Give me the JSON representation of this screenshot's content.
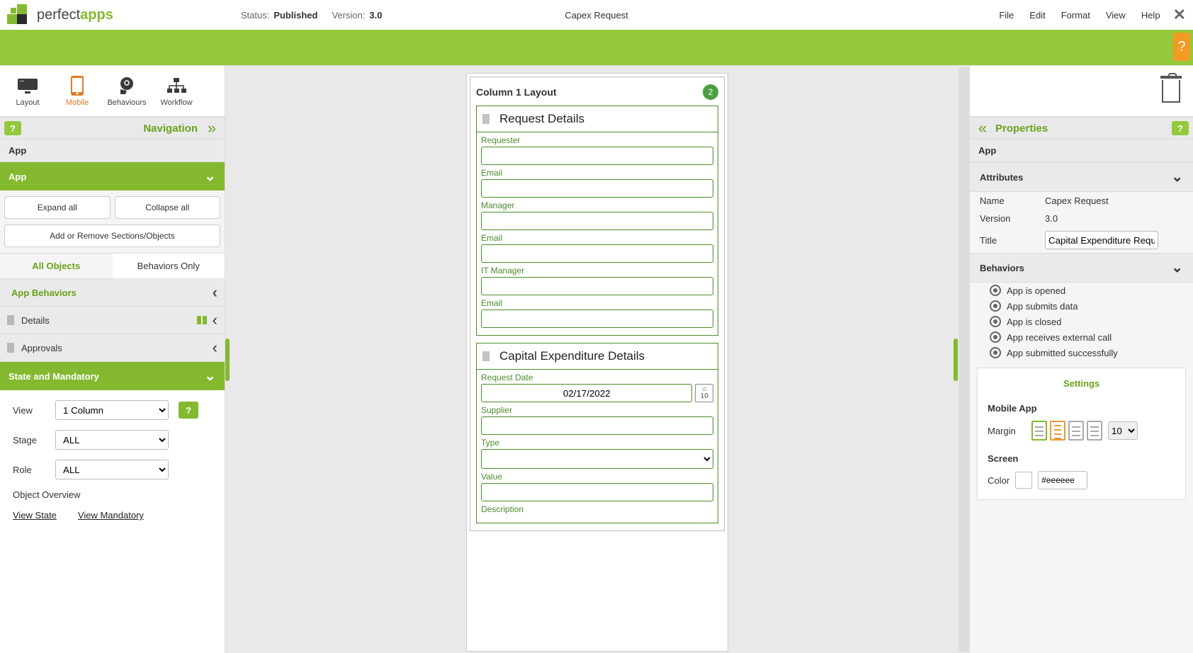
{
  "branding": {
    "name1": "perfect",
    "name2": "apps"
  },
  "header": {
    "status_label": "Status:",
    "status_value": "Published",
    "version_label": "Version:",
    "version_value": "3.0",
    "app_title": "Capex Request",
    "menu": {
      "file": "File",
      "edit": "Edit",
      "format": "Format",
      "view": "View",
      "help": "Help"
    }
  },
  "tools": {
    "layout": "Layout",
    "mobile": "Mobile",
    "behaviours": "Behaviours",
    "workflow": "Workflow"
  },
  "nav": {
    "title": "Navigation",
    "section_label": "App",
    "app_expand": "App",
    "expand_all": "Expand all",
    "collapse_all": "Collapse all",
    "add_remove": "Add or Remove Sections/Objects",
    "tab_all": "All Objects",
    "tab_beh": "Behaviors Only",
    "app_behaviors": "App Behaviors",
    "details": "Details",
    "approvals": "Approvals",
    "state_mand": "State and Mandatory",
    "view_label": "View",
    "view_value": "1 Column",
    "stage_label": "Stage",
    "stage_value": "ALL",
    "role_label": "Role",
    "role_value": "ALL",
    "overview": "Object Overview",
    "view_state": "View State",
    "view_mandatory": "View Mandatory"
  },
  "canvas": {
    "title": "Column 1 Layout",
    "badge": "2",
    "sec1_title": "Request Details",
    "f_requester": "Requester",
    "f_email": "Email",
    "f_manager": "Manager",
    "f_email2": "Email",
    "f_itmgr": "IT Manager",
    "f_email3": "Email",
    "sec2_title": "Capital Expenditure Details",
    "f_reqdate": "Request Date",
    "f_reqdate_val": "02/17/2022",
    "f_supplier": "Supplier",
    "f_type": "Type",
    "f_value": "Value",
    "f_desc": "Description"
  },
  "props": {
    "title": "Properties",
    "app_label": "App",
    "attributes": "Attributes",
    "name_label": "Name",
    "name_value": "Capex Request",
    "version_label": "Version",
    "version_value": "3.0",
    "title_label": "Title",
    "title_value": "Capital Expenditure Request",
    "behaviors": "Behaviors",
    "b1": "App is opened",
    "b2": "App submits data",
    "b3": "App is closed",
    "b4": "App receives external call",
    "b5": "App submitted successfully",
    "settings": "Settings",
    "mobile_app": "Mobile App",
    "margin": "Margin",
    "margin_val": "10",
    "screen": "Screen",
    "color": "Color",
    "color_val": "#eeeeee"
  }
}
